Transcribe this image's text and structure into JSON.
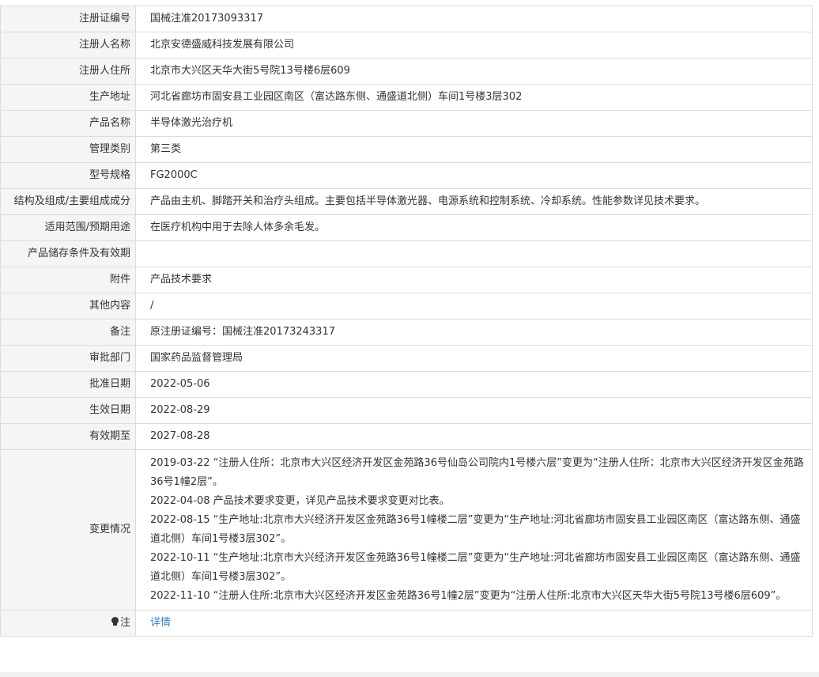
{
  "rows": [
    {
      "label": "注册证编号",
      "value": "国械注准20173093317"
    },
    {
      "label": "注册人名称",
      "value": "北京安德盛威科技发展有限公司"
    },
    {
      "label": "注册人住所",
      "value": "北京市大兴区天华大街5号院13号楼6层609"
    },
    {
      "label": "生产地址",
      "value": "河北省廊坊市固安县工业园区南区（富达路东侧、通盛道北侧）车间1号楼3层302"
    },
    {
      "label": "产品名称",
      "value": "半导体激光治疗机"
    },
    {
      "label": "管理类别",
      "value": "第三类"
    },
    {
      "label": "型号规格",
      "value": "FG2000C"
    },
    {
      "label": "结构及组成/主要组成成分",
      "value": "产品由主机、脚踏开关和治疗头组成。主要包括半导体激光器、电源系统和控制系统、冷却系统。性能参数详见技术要求。"
    },
    {
      "label": "适用范围/预期用途",
      "value": "在医疗机构中用于去除人体多余毛发。"
    },
    {
      "label": "产品储存条件及有效期",
      "value": ""
    },
    {
      "label": "附件",
      "value": "产品技术要求"
    },
    {
      "label": "其他内容",
      "value": "/"
    },
    {
      "label": "备注",
      "value": "原注册证编号：国械注准20173243317"
    },
    {
      "label": "审批部门",
      "value": "国家药品监督管理局"
    },
    {
      "label": "批准日期",
      "value": "2022-05-06"
    },
    {
      "label": "生效日期",
      "value": "2022-08-29"
    },
    {
      "label": "有效期至",
      "value": "2027-08-28"
    }
  ],
  "changes": {
    "label": "变更情况",
    "entries": [
      "2019-03-22 “注册人住所：北京市大兴区经济开发区金苑路36号仙岛公司院内1号楼六层”变更为“注册人住所：北京市大兴区经济开发区金苑路36号1幢2层”。",
      "2022-04-08 产品技术要求变更，详见产品技术要求变更对比表。",
      "2022-08-15 “生产地址:北京市大兴经济开发区金苑路36号1幢楼二层”变更为“生产地址:河北省廊坊市固安县工业园区南区（富达路东侧、通盛道北侧）车间1号楼3层302”。",
      "2022-10-11 “生产地址:北京市大兴经济开发区金苑路36号1幢楼二层”变更为“生产地址:河北省廊坊市固安县工业园区南区（富达路东侧、通盛道北侧）车间1号楼3层302”。",
      "2022-11-10 “注册人住所:北京市大兴区经济开发区金苑路36号1幢2层”变更为“注册人住所:北京市大兴区天华大街5号院13号楼6层609”。"
    ]
  },
  "note": {
    "label": "注",
    "icon": "lightbulb-icon",
    "link_text": "详情",
    "link_color": "#3a7cc7"
  }
}
